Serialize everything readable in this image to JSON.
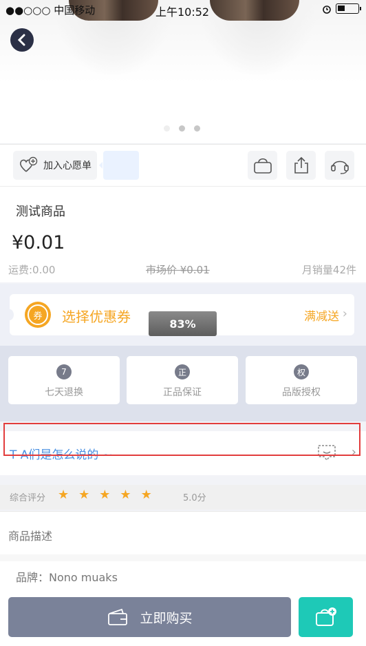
{
  "status_bar": {
    "carrier": "●●○○○ 中国移动",
    "time": "上午10:52"
  },
  "gallery": {
    "slide_count": 3,
    "active_slide": 0
  },
  "actions": {
    "wishlist_label": "加入心愿单"
  },
  "product": {
    "name": "测试商品",
    "price": "¥0.01",
    "shipping": "运费:0.00",
    "market_price": "市场价 ¥0.01",
    "monthly_sales": "月销量42件"
  },
  "coupon": {
    "badge": "券",
    "title": "选择优惠券",
    "promo": "满减送"
  },
  "loading_toast": "83%",
  "guarantees": [
    {
      "icon": "7",
      "label": "七天退换"
    },
    {
      "icon": "正",
      "label": "正品保证"
    },
    {
      "icon": "权",
      "label": "品版授权"
    }
  ],
  "reviews": {
    "title": "T A们是怎么说的 ~"
  },
  "rating": {
    "label": "综合评分",
    "stars": 5,
    "score": "5.0分"
  },
  "description": {
    "heading": "商品描述",
    "brand": "品牌：Nono muaks"
  },
  "bottom": {
    "buy_label": "立即购买"
  },
  "colors": {
    "accent_orange": "#f5a623",
    "review_blue": "#4a90e2",
    "buy_bg": "#7a8299",
    "cart_bg": "#1ec9b7",
    "highlight_red": "#e23c3c"
  }
}
